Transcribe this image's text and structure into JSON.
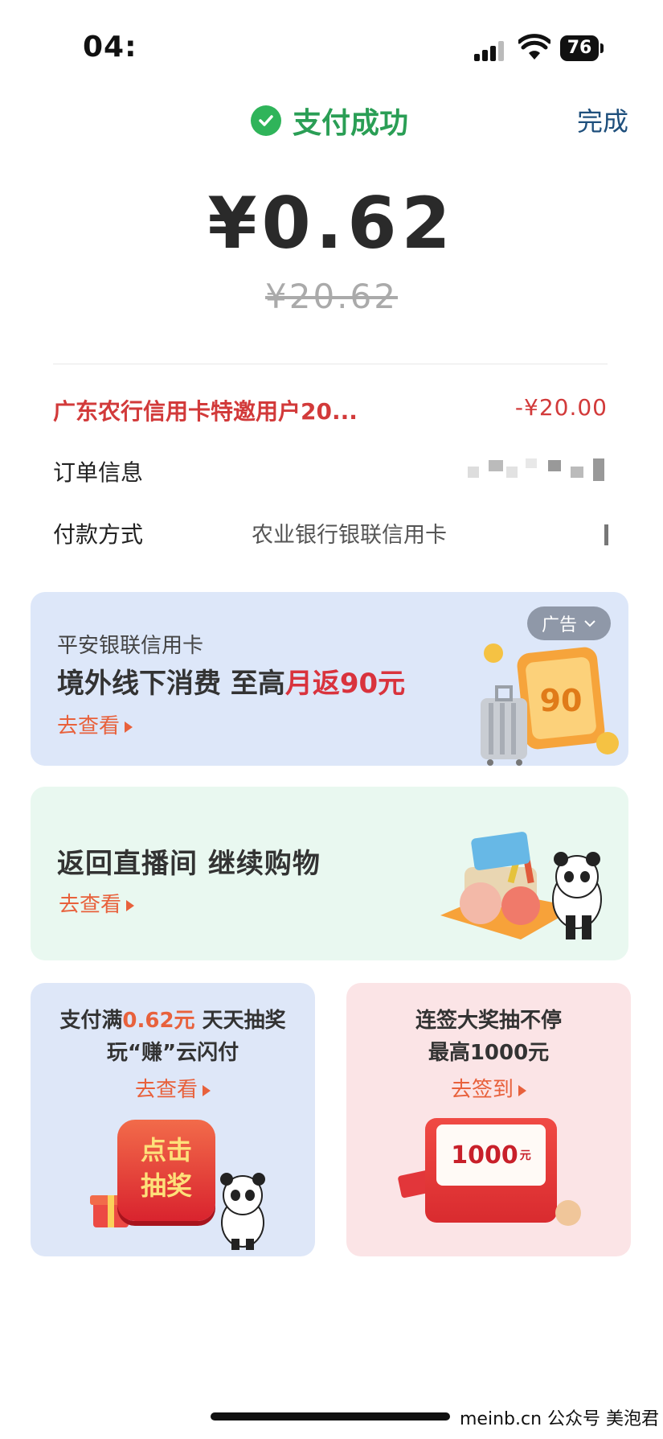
{
  "status_bar": {
    "time": "04:",
    "battery": "76"
  },
  "header": {
    "status_text": "支付成功",
    "done_label": "完成"
  },
  "payment": {
    "amount": "¥0.62",
    "original_amount": "¥20.62"
  },
  "details": {
    "discount_label": "广东农行信用卡特邀用户20...",
    "discount_value": "-¥20.00",
    "order_label": "订单信息",
    "pay_method_label": "付款方式",
    "pay_method_value": "农业银行银联信用卡"
  },
  "promo_pingan": {
    "title": "平安银联信用卡",
    "main_prefix": "境外线下消费  至高",
    "main_highlight": "月返90元",
    "link": "去查看",
    "ad_label": "广告",
    "coupon_value": "90"
  },
  "promo_live": {
    "title": "返回直播间  继续购物",
    "link": "去查看"
  },
  "promo_lottery": {
    "line1_prefix": "支付满",
    "line1_highlight": "0.62元",
    "line1_suffix": " 天天抽奖",
    "line2": "玩“赚”云闪付",
    "link": "去查看",
    "button_line1": "点击",
    "button_line2": "抽奖"
  },
  "promo_sign": {
    "line1": "连签大奖抽不停",
    "line2": "最高1000元",
    "link": "去签到",
    "prize_value": "1000",
    "prize_unit": "元"
  },
  "watermark": "meinb.cn  公众号 美泡君",
  "colors": {
    "success_green": "#2fb45a",
    "discount_red": "#d23a3a",
    "link_orange": "#e8613c",
    "done_blue": "#1e4f7c"
  }
}
